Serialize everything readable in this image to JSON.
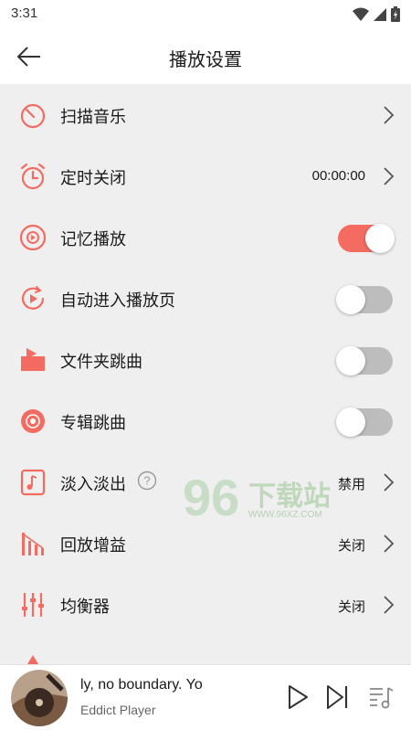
{
  "status_bar": {
    "time": "3:31",
    "icons": [
      "wifi-icon",
      "signal-icon",
      "battery-icon"
    ]
  },
  "header": {
    "title": "播放设置",
    "back_icon": "arrow-left-icon"
  },
  "colors": {
    "accent": "#f36b61",
    "background": "#efefef",
    "toggle_off": "#bdbdbd"
  },
  "settings": [
    {
      "label": "扫描音乐",
      "icon": "scan-icon",
      "control": "chevron"
    },
    {
      "label": "定时关闭",
      "icon": "alarm-clock-icon",
      "control": "chevron",
      "value": "00:00:00"
    },
    {
      "label": "记忆播放",
      "icon": "memory-play-icon",
      "control": "toggle",
      "on": true
    },
    {
      "label": "自动进入播放页",
      "icon": "auto-play-page-icon",
      "control": "toggle",
      "on": false
    },
    {
      "label": "文件夹跳曲",
      "icon": "folder-icon",
      "control": "toggle",
      "on": false
    },
    {
      "label": "专辑跳曲",
      "icon": "album-disc-icon",
      "control": "toggle",
      "on": false
    },
    {
      "label": "淡入淡出",
      "icon": "fade-icon",
      "control": "chevron",
      "value": "禁用",
      "help_icon": "question-icon"
    },
    {
      "label": "回放增益",
      "icon": "replay-gain-icon",
      "control": "chevron",
      "value": "关闭"
    },
    {
      "label": "均衡器",
      "icon": "equalizer-icon",
      "control": "chevron",
      "value": "关闭"
    }
  ],
  "watermark": {
    "number": "96",
    "text": "下载站",
    "url": "WWW.96XZ.COM"
  },
  "player": {
    "song": "ly, no boundary.  Yo",
    "artist": "Eddict Player",
    "play_icon": "play-icon",
    "next_icon": "skip-next-icon",
    "playlist_icon": "playlist-icon"
  }
}
